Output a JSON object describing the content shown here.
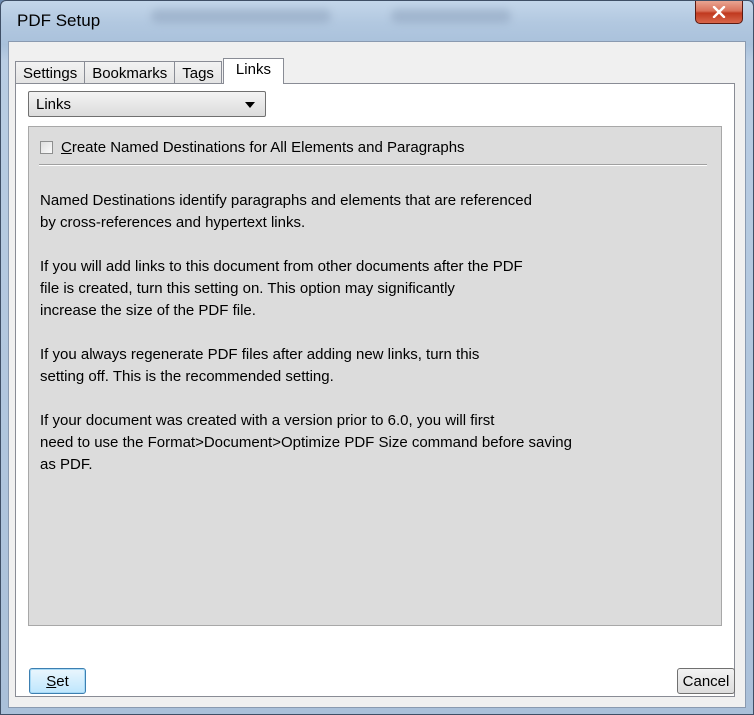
{
  "window": {
    "title": "PDF Setup",
    "close_label": "X"
  },
  "tabs": [
    {
      "label": "Settings"
    },
    {
      "label": "Bookmarks"
    },
    {
      "label": "Tags"
    },
    {
      "label": "Links",
      "active": true
    }
  ],
  "dropdown": {
    "selected": "Links"
  },
  "checkbox": {
    "mnemonic": "C",
    "label_rest": "reate Named Destinations for All Elements and Paragraphs",
    "checked": false
  },
  "paragraphs": [
    [
      "Named Destinations identify paragraphs and elements that are referenced",
      "by cross-references and hypertext links."
    ],
    [
      "If you will add links to this document from other documents after the PDF",
      "file is created, turn this setting on.  This option may significantly",
      "increase the size of the PDF file."
    ],
    [
      "If you always regenerate PDF files after adding new links, turn this",
      "setting off.  This is the recommended setting."
    ],
    [
      "If your document was created with a version prior to 6.0, you will first",
      "need to use the Format>Document>Optimize PDF Size command before saving",
      "as PDF."
    ]
  ],
  "buttons": {
    "set_mnemonic": "S",
    "set_rest": "et",
    "cancel": "Cancel"
  },
  "colors": {
    "titlebar": "#b2c8e0",
    "close_button": "#c0391f",
    "panel_background": "#dcdcdc",
    "set_button_border": "#3c7fb1"
  }
}
